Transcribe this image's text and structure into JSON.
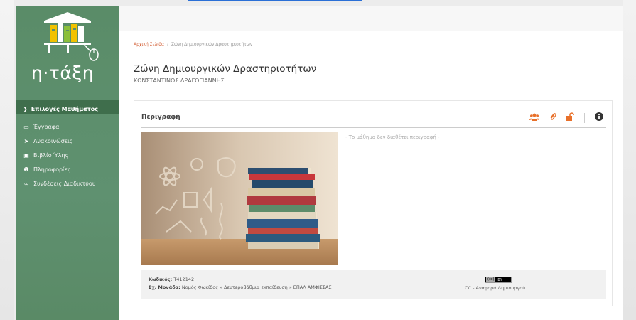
{
  "app": {
    "logo_text": "η·τάξη"
  },
  "sidebar": {
    "section_label": "Επιλογές Μαθήματος",
    "items": [
      {
        "label": "Έγγραφα",
        "icon": "folder-icon"
      },
      {
        "label": "Ανακοινώσεις",
        "icon": "megaphone-icon"
      },
      {
        "label": "Βιβλίο Ύλης",
        "icon": "calendar-icon"
      },
      {
        "label": "Πληροφορίες",
        "icon": "info-icon"
      },
      {
        "label": "Συνδέσεις Διαδικτύου",
        "icon": "link-icon"
      }
    ]
  },
  "breadcrumb": {
    "home": "Αρχική Σελίδα",
    "separator": "/",
    "current": "Ζώνη Δημιουργικών Δραστηριοτήτων"
  },
  "course": {
    "title": "Ζώνη Δημιουργικών Δραστηριοτήτων",
    "instructor": "ΚΩΝΣΤΑΝΤΙΝΟΣ ΔΡΑΓΟΓΙΑΝΝΗΣ"
  },
  "panel": {
    "title": "Περιγραφή",
    "no_description": "- Το μάθημα δεν διαθέτει περιγραφή -",
    "icons": [
      "users-icon",
      "paperclip-icon",
      "unlock-icon",
      "info-icon"
    ]
  },
  "footer": {
    "code_label": "Κωδικός:",
    "code_value": "T412142",
    "unit_label": "Σχ. Μονάδα:",
    "unit_value": "Νομός Φωκίδος » Δευτεροβάθμια εκπαίδευση » ΕΠΑΛ ΑΜΦΙΣΣΑΣ",
    "license_badge_cc": "(cc)",
    "license_badge_by": "BY",
    "license_text": "CC - Αναφορά Δημιουργού"
  },
  "colors": {
    "sidebar": "#5d8e6a",
    "sidebar_header": "#3f6e4c",
    "accent": "#e8702a",
    "breadcrumb_home": "#d15b30"
  }
}
